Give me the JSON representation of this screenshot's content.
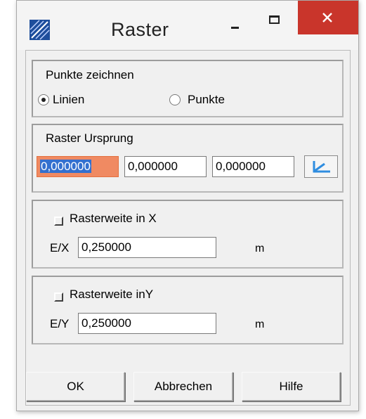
{
  "window": {
    "title": "Raster"
  },
  "draw_group": {
    "label": "Punkte zeichnen",
    "options": [
      {
        "label": "Linien",
        "selected": true
      },
      {
        "label": "Punkte",
        "selected": false
      }
    ]
  },
  "origin_group": {
    "label": "Raster Ursprung",
    "x": "0,000000",
    "y": "0,000000",
    "z": "0,000000"
  },
  "spacing_x": {
    "checkbox_label": "Rasterweite in X",
    "axis_label": "E/X",
    "value": "0,250000",
    "unit": "m",
    "checked": false
  },
  "spacing_y": {
    "checkbox_label": "Rasterweite inY",
    "axis_label": "E/Y",
    "value": "0,250000",
    "unit": "m",
    "checked": false
  },
  "buttons": {
    "ok": "OK",
    "cancel": "Abbrechen",
    "help": "Hilfe"
  },
  "colors": {
    "close_button": "#c9352b",
    "selected_field": "#f08a62",
    "selection_highlight": "#3370cf",
    "pick_icon": "#2f8de0"
  },
  "icons": {
    "app": "raster-app-icon",
    "pick": "pick-origin-icon"
  }
}
